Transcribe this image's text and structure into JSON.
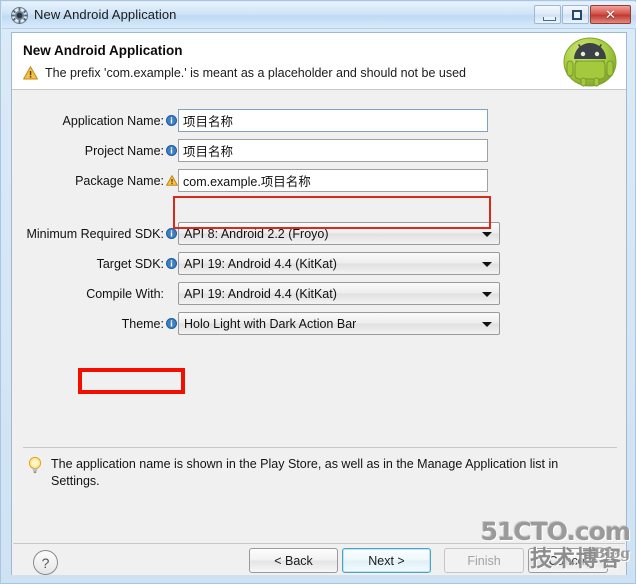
{
  "window": {
    "title": "New Android Application",
    "icon": "android-settings-icon",
    "controls": {
      "minimize_label": "",
      "maximize_label": "",
      "close_label": "✕"
    }
  },
  "header": {
    "title": "New Android Application",
    "warning_icon": "warning-triangle-icon",
    "warning_text": "The prefix 'com.example.' is meant as a placeholder and should not be used",
    "mascot_icon": "android-mascot-icon"
  },
  "form": {
    "fields": [
      {
        "label": "Application Name:",
        "hint_icon": "info-icon",
        "hint_type": "info",
        "type": "text",
        "value": "项目名称",
        "placeholder": "",
        "focused": true,
        "highlighted": true
      },
      {
        "label": "Project Name:",
        "hint_icon": "info-icon",
        "hint_type": "info",
        "type": "text",
        "value": "项目名称",
        "placeholder": "",
        "focused": false,
        "highlighted": false
      },
      {
        "label": "Package Name:",
        "hint_icon": "warning-triangle-icon",
        "hint_type": "warning",
        "type": "text",
        "value": "com.example.项目名称",
        "placeholder": "",
        "focused": false,
        "highlighted": false
      }
    ],
    "dropdowns": [
      {
        "label": "Minimum Required SDK:",
        "hint_icon": "info-icon",
        "hint_type": "info",
        "value": "API 8: Android 2.2 (Froyo)",
        "highlighted": false
      },
      {
        "label": "Target SDK:",
        "hint_icon": "info-icon",
        "hint_type": "info",
        "value": "API 19: Android 4.4 (KitKat)",
        "highlighted": false
      },
      {
        "label": "Compile With:",
        "hint_icon": "",
        "hint_type": "none",
        "value": "API 19: Android 4.4 (KitKat)",
        "highlighted": true
      },
      {
        "label": "Theme:",
        "hint_icon": "info-icon",
        "hint_type": "info",
        "value": "Holo Light with Dark Action Bar",
        "highlighted": false
      }
    ]
  },
  "hint": {
    "icon": "lightbulb-icon",
    "text": "The application name is shown in the Play Store, as well as in the Manage Application list in Settings."
  },
  "buttons": {
    "help": "?",
    "back": "< Back",
    "next": "Next >",
    "finish": "Finish",
    "cancel": "Cancel"
  },
  "watermark": {
    "line1": "51CTO.com",
    "line2": "技术博客",
    "line3": "Blog"
  },
  "colors": {
    "accent_red": "#f20f00",
    "annotation_red": "#d92b1c",
    "focus_blue": "#4aa3c7",
    "android_green": "#a4c639",
    "title_bar": "#cfe4f7"
  }
}
